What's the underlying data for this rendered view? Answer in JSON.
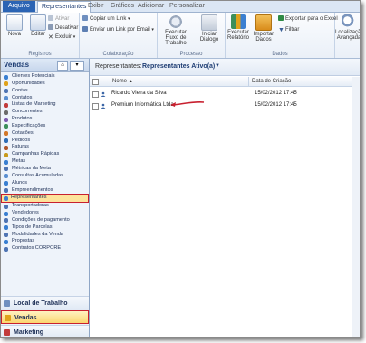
{
  "tabs": {
    "file": "Arquivo",
    "active": "Representantes",
    "t3": "Exibir",
    "t4": "Gráficos",
    "t5": "Adicionar",
    "t6": "Personalizar"
  },
  "ribbon": {
    "registros": {
      "label": "Registros",
      "nova": "Nova",
      "editar": "Editar",
      "ativar": "Ativar",
      "desativar": "Desativar",
      "excluir": "Excluir"
    },
    "colaboracao": {
      "label": "Colaboração",
      "copiar_link": "Copiar um Link",
      "enviar_link": "Enviar um Link por Email"
    },
    "processo": {
      "label": "Processo",
      "fluxo": "Executar Fluxo de Trabalho",
      "dialogo": "Iniciar Diálogo"
    },
    "dados": {
      "label": "Dados",
      "relatorio": "Executar Relatório",
      "importar": "Importar Dados",
      "exportar": "Exportar para o Excel",
      "filtrar": "Filtrar"
    },
    "localizacao": {
      "label": "Localização Avançada"
    }
  },
  "nav": {
    "title": "Vendas",
    "home_icon": "home-icon",
    "items": [
      {
        "label": "Clientes Potenciais",
        "color": "#3a7fd1"
      },
      {
        "label": "Oportunidades",
        "color": "#e0a21b"
      },
      {
        "label": "Contas",
        "color": "#4f74b3"
      },
      {
        "label": "Contatos",
        "color": "#5a8ed0"
      },
      {
        "label": "Listas de Marketing",
        "color": "#c23b3b"
      },
      {
        "label": "Concorrentes",
        "color": "#6b6b6b"
      },
      {
        "label": "Produtos",
        "color": "#7e5bb0"
      },
      {
        "label": "Especificações",
        "color": "#3c8f5a"
      },
      {
        "label": "Cotações",
        "color": "#d2782a"
      },
      {
        "label": "Pedidos",
        "color": "#2f6db5"
      },
      {
        "label": "Faturas",
        "color": "#b0562a"
      },
      {
        "label": "Campanhas Rápidas",
        "color": "#c89a1c"
      },
      {
        "label": "Metas",
        "color": "#3a7fd1"
      },
      {
        "label": "Métricas da Meta",
        "color": "#4f74b3"
      },
      {
        "label": "Consultas Acumuladas",
        "color": "#5a8ed0"
      },
      {
        "label": "Alunos",
        "color": "#3a7fd1"
      },
      {
        "label": "Empreendimentos",
        "color": "#4f74b3"
      },
      {
        "label": "Representantes",
        "color": "#3a7fd1"
      },
      {
        "label": "Transportadoras",
        "color": "#4f74b3"
      },
      {
        "label": "Vendedores",
        "color": "#3a7fd1"
      },
      {
        "label": "Condições de pagamento",
        "color": "#4f74b3"
      },
      {
        "label": "Tipos de Parcelas",
        "color": "#3a7fd1"
      },
      {
        "label": "Modalidades da Venda",
        "color": "#4f74b3"
      },
      {
        "label": "Propostas",
        "color": "#3a7fd1"
      },
      {
        "label": "Contratos CORPORE",
        "color": "#4f74b3"
      }
    ],
    "selected_index": 17,
    "areas": {
      "local": "Local de Trabalho",
      "vendas": "Vendas",
      "marketing": "Marketing"
    }
  },
  "main": {
    "view_label": "Representantes:",
    "view_value": "Representantes Ativo(a)",
    "col_name": "Nome",
    "col_date": "Data de Criação",
    "sort_indicator": "▲",
    "rows": [
      {
        "name": "Ricardo Vieira da Silva",
        "date": "15/02/2012 17:45"
      },
      {
        "name": "Premium Informática Ltda",
        "date": "15/02/2012 17:45"
      }
    ]
  },
  "colors": {
    "accent": "#2b64b4",
    "highlight": "#c8202f",
    "selected_bg": "#fde39b"
  }
}
